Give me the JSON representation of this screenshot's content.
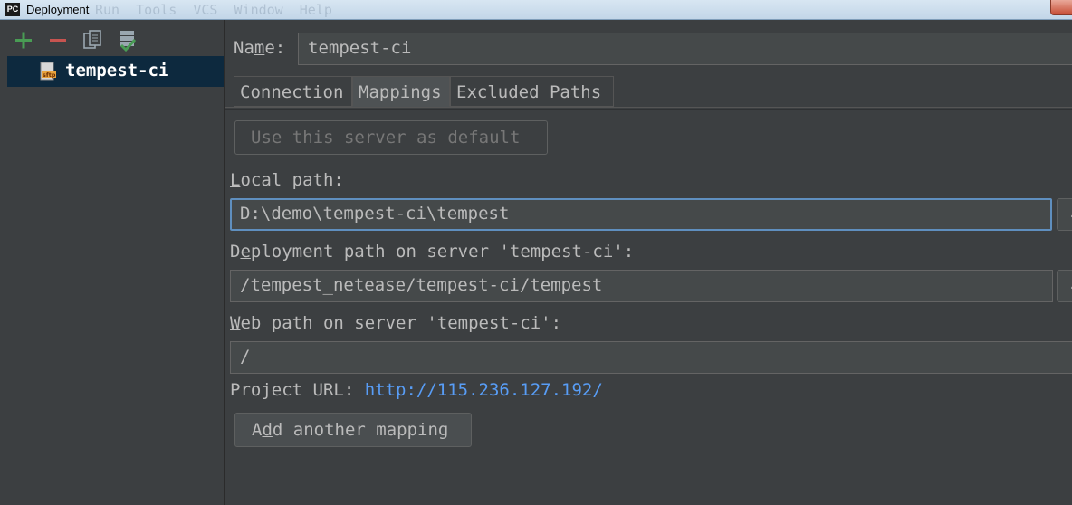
{
  "window": {
    "title": "Deployment",
    "app_icon_text": "PC",
    "background_menu": "Run  Tools  VCS  Window  Help"
  },
  "toolbar": {
    "add": "add-icon",
    "remove": "remove-icon",
    "copy": "copy-icon",
    "default": "use-as-default-icon"
  },
  "tree": {
    "items": [
      {
        "label": "tempest-ci",
        "icon": "sftp-server-icon",
        "selected": true
      }
    ]
  },
  "form": {
    "name_label_pre": "Na",
    "name_label_u": "m",
    "name_label_post": "e:",
    "name_value": "tempest-ci",
    "tabs": [
      {
        "label": "Connection",
        "active": false
      },
      {
        "label": "Mappings",
        "active": true
      },
      {
        "label": "Excluded Paths",
        "active": false
      }
    ],
    "default_button": "Use this server as default",
    "local_path": {
      "label_u": "L",
      "label_post": "ocal path:",
      "value": "D:\\demo\\tempest-ci\\tempest"
    },
    "deployment_path": {
      "label_pre": "D",
      "label_u": "e",
      "label_post": "ployment path on server 'tempest-ci':",
      "value": "/tempest_netease/tempest-ci/tempest"
    },
    "web_path": {
      "label_u": "W",
      "label_post": "eb path on server 'tempest-ci':",
      "value": "/"
    },
    "project_url_label": "Project URL: ",
    "project_url": "http://115.236.127.192/",
    "add_mapping": {
      "pre": "A",
      "u": "d",
      "post": "d another mapping"
    },
    "browse_label": "..."
  },
  "colors": {
    "background": "#3c3f41",
    "selection": "#0d293e",
    "link": "#589df6",
    "focus_border": "#5f8fbf",
    "add_green": "#499c54",
    "remove_red": "#c75450"
  }
}
